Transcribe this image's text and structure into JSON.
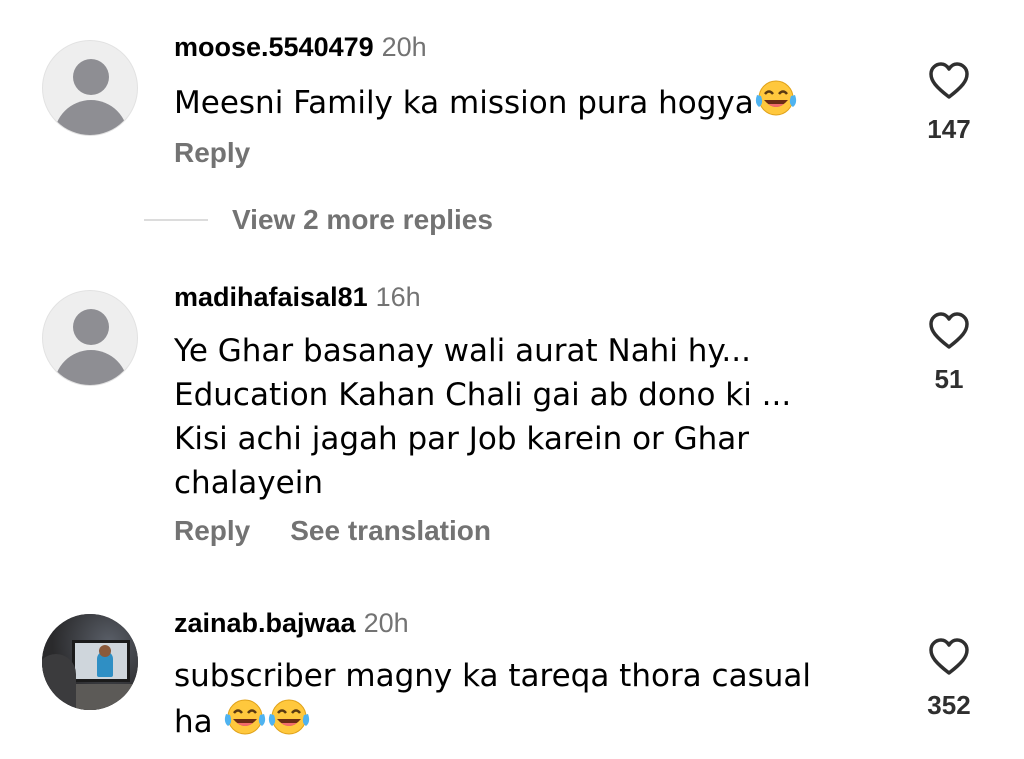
{
  "comments": [
    {
      "username": "moose.5540479",
      "time": "20h",
      "text": "Meesni Family ka mission pura hogya",
      "emoji_after": "laughing-tears",
      "actions": {
        "reply": "Reply"
      },
      "likes": "147",
      "view_more": "View 2 more replies"
    },
    {
      "username": "madihafaisal81",
      "time": "16h",
      "text_lines": [
        "Ye Ghar basanay wali aurat Nahi hy...",
        "Education Kahan Chali gai ab dono ki ...",
        "Kisi achi jagah par Job karein or Ghar",
        "chalayein"
      ],
      "actions": {
        "reply": "Reply",
        "translate": "See translation"
      },
      "likes": "51"
    },
    {
      "username": "zainab.bajwaa",
      "time": "20h",
      "text_lines": [
        "subscriber magny ka tareqa thora casual",
        "ha"
      ],
      "emoji_after": "laughing-tears x2",
      "likes": "352"
    }
  ],
  "icons": {
    "like": "heart-outline-icon",
    "avatar_default": "default-avatar-icon",
    "emoji": "face-with-tears-of-joy-icon"
  },
  "colors": {
    "secondary_text": "#737373",
    "primary_text": "#000000",
    "divider": "#dcdcdc"
  }
}
